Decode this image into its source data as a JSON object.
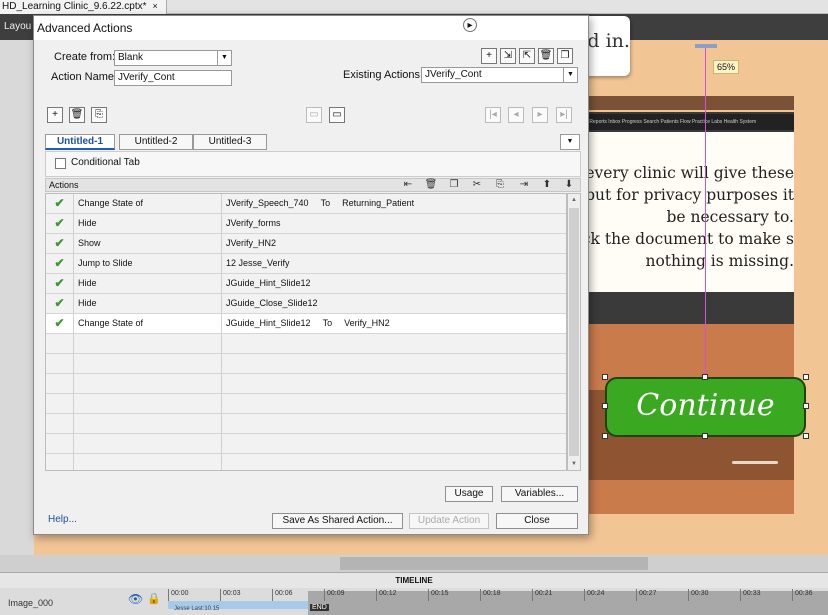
{
  "app": {
    "document_tab": "HD_Learning Clinic_9.6.22.cptx*",
    "document_tab_close": "×",
    "layout_label": "Layou"
  },
  "stage": {
    "card_text": "cked in.",
    "zoom": "65%",
    "screen_lines": [
      "every clinic will give these",
      ", but for privacy purposes it",
      "be necessary to.",
      "heck the document to make s",
      "nothing is missing."
    ],
    "monitor_bar_text": "Patient Ticket  Reports  Inbox  Progress  Search  Patients  Flow  Practice  Labs  Health System",
    "continue_label": "Continue"
  },
  "timeline": {
    "title": "TIMELINE",
    "layer_name": "Image_000",
    "ticks": [
      "00:00",
      "00:03",
      "00:06",
      "00:09",
      "00:12",
      "00:15",
      "00:18",
      "00:21",
      "00:24",
      "00:27",
      "00:30",
      "00:33",
      "00:36"
    ],
    "end_label": "END",
    "track_label": "Jesse Last:10.15"
  },
  "dialog": {
    "title": "Advanced Actions",
    "create_from_label": "Create from:",
    "create_from_value": "Blank",
    "action_name_label": "Action Name:",
    "action_name_value": "JVerify_Cont",
    "existing_actions_label": "Existing Actions:",
    "existing_actions_value": "JVerify_Cont",
    "tabs": [
      "Untitled-1",
      "Untitled-2",
      "Untitled-3"
    ],
    "conditional_tab_label": "Conditional Tab",
    "actions_header": "Actions",
    "actions": [
      {
        "check": "✔",
        "action": "Change State of",
        "target": "JVerify_Speech_740",
        "to": "To",
        "state": "Returning_Patient"
      },
      {
        "check": "✔",
        "action": "Hide",
        "target": "JVerify_forms",
        "to": "",
        "state": ""
      },
      {
        "check": "✔",
        "action": "Show",
        "target": "JVerify_HN2",
        "to": "",
        "state": ""
      },
      {
        "check": "✔",
        "action": "Jump to Slide",
        "target": "12 Jesse_Verify",
        "to": "",
        "state": ""
      },
      {
        "check": "✔",
        "action": "Hide",
        "target": "JGuide_Hint_Slide12",
        "to": "",
        "state": ""
      },
      {
        "check": "✔",
        "action": "Hide",
        "target": "JGuide_Close_Slide12",
        "to": "",
        "state": ""
      },
      {
        "check": "✔",
        "action": "Change State of",
        "target": "JGuide_Hint_Slide12",
        "to": "To",
        "state": "Verify_HN2"
      }
    ],
    "empty_rows": 7,
    "buttons": {
      "usage": "Usage",
      "variables": "Variables...",
      "help": "Help...",
      "save_shared": "Save As Shared Action...",
      "update": "Update Action",
      "close": "Close"
    }
  },
  "colors": {
    "accent": "#1f5fb8",
    "check_green": "#3a9a2e",
    "continue_green": "#3aa821",
    "stage_wall": "#f2c595"
  }
}
